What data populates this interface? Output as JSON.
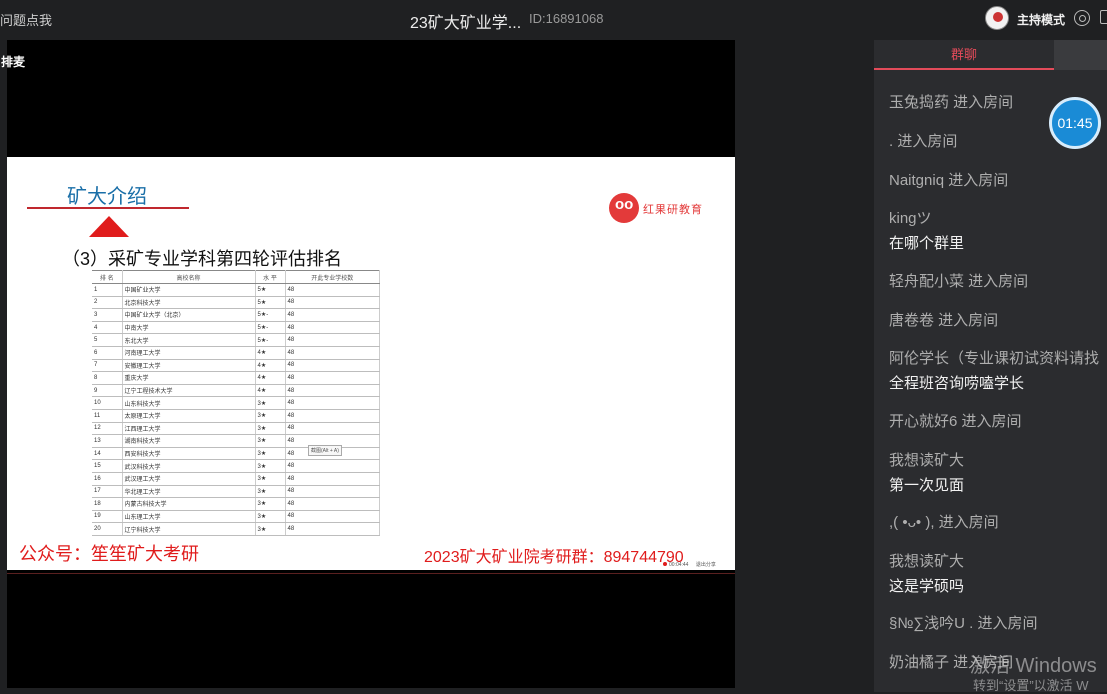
{
  "topbar": {
    "left_text": "问题点我",
    "title": "23矿大矿业学...",
    "room_id": "ID:16891068",
    "host_mode": "主持模式"
  },
  "video": {
    "tag": "排麦",
    "slide": {
      "heading": "矿大介绍",
      "logo_text": "红果研教育",
      "subtitle": "（3）采矿专业学科第四轮评估排名",
      "table": {
        "headers": [
          "排 名",
          "高校名称",
          "水 平",
          "开此专业学校数"
        ],
        "rows": [
          [
            "1",
            "中国矿业大学",
            "5★",
            "48"
          ],
          [
            "2",
            "北京科技大学",
            "5★",
            "48"
          ],
          [
            "3",
            "中国矿业大学（北京）",
            "5★-",
            "48"
          ],
          [
            "4",
            "中南大学",
            "5★-",
            "48"
          ],
          [
            "5",
            "东北大学",
            "5★-",
            "48"
          ],
          [
            "6",
            "河南理工大学",
            "4★",
            "48"
          ],
          [
            "7",
            "安徽理工大学",
            "4★",
            "48"
          ],
          [
            "8",
            "重庆大学",
            "4★",
            "48"
          ],
          [
            "9",
            "辽宁工程技术大学",
            "4★",
            "48"
          ],
          [
            "10",
            "山东科技大学",
            "3★",
            "48"
          ],
          [
            "11",
            "太原理工大学",
            "3★",
            "48"
          ],
          [
            "12",
            "江西理工大学",
            "3★",
            "48"
          ],
          [
            "13",
            "湖南科技大学",
            "3★",
            "48"
          ],
          [
            "14",
            "西安科技大学",
            "3★",
            "48"
          ],
          [
            "15",
            "武汉科技大学",
            "3★",
            "48"
          ],
          [
            "16",
            "武汉理工大学",
            "3★",
            "48"
          ],
          [
            "17",
            "华北理工大学",
            "3★",
            "48"
          ],
          [
            "18",
            "内蒙古科技大学",
            "3★",
            "48"
          ],
          [
            "19",
            "山东理工大学",
            "3★",
            "48"
          ],
          [
            "20",
            "辽宁科技大学",
            "3★",
            "48"
          ]
        ]
      },
      "tooltip": "截图(Alt + A)",
      "footer_left": "公众号：笙笙矿大考研",
      "footer_right": "2023矿大矿业院考研群：894744790",
      "rec_time": "00:04:44",
      "rec_exit": "退出分享"
    }
  },
  "chat": {
    "tab_active": "群聊",
    "timer": "01:45",
    "messages": [
      {
        "name": "玉兔捣药 进入房间",
        "body": ""
      },
      {
        "name": ". 进入房间",
        "body": ""
      },
      {
        "name": "Naitgniq 进入房间",
        "body": ""
      },
      {
        "name": "kingツ",
        "body": "在哪个群里"
      },
      {
        "name": "轻舟配小菜 进入房间",
        "body": ""
      },
      {
        "name": "唐卷卷 进入房间",
        "body": ""
      },
      {
        "name": "阿伦学长（专业课初试资料请找",
        "body": "全程班咨询唠嗑学长"
      },
      {
        "name": "开心就好6 进入房间",
        "body": ""
      },
      {
        "name": "我想读矿大",
        "body": "第一次见面"
      },
      {
        "name": ",( •ᴗ• ), 进入房间",
        "body": ""
      },
      {
        "name": "我想读矿大",
        "body": "这是学硕吗"
      },
      {
        "name": "§№∑浅吟U . 进入房间",
        "body": ""
      },
      {
        "name": "奶油橘子 进入房间",
        "body": ""
      }
    ]
  },
  "watermark": {
    "line1": "激活 Windows",
    "line2": "转到“设置”以激活 W"
  }
}
